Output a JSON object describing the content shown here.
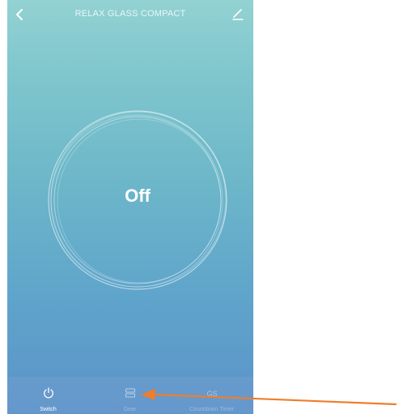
{
  "header": {
    "title": "RELAX GLASS COMPACT",
    "back_icon": "chevron-left-icon",
    "edit_icon": "pencil-icon"
  },
  "main": {
    "state": "Off"
  },
  "tabs": [
    {
      "label": "Switch",
      "icon": "power-icon",
      "active": true
    },
    {
      "label": "Gear",
      "icon": "gear-levels-icon",
      "active": false
    },
    {
      "label": "Countdown Timer",
      "icon": "timer-icon",
      "active": false
    }
  ],
  "annotation": {
    "color": "#f07d2a",
    "points_to": "Gear"
  },
  "colors": {
    "background_top": "#93d2d2",
    "background_bottom": "#5b93c9",
    "accent": "#ffffff"
  }
}
